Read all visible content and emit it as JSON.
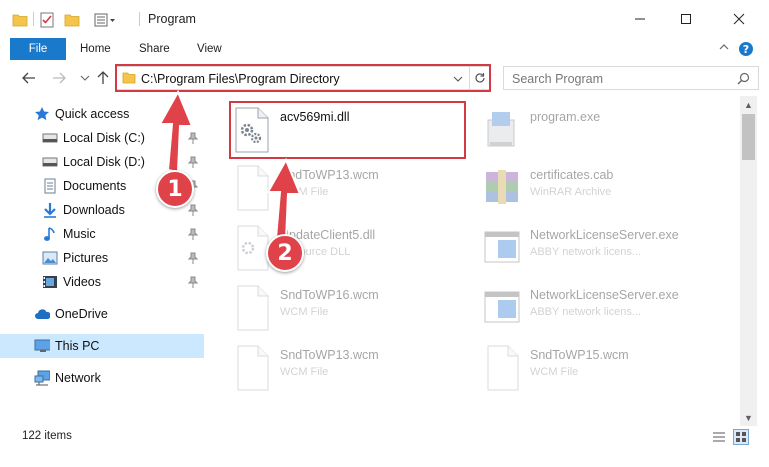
{
  "window": {
    "title": "Program",
    "minimize_icon": "minimize-icon",
    "maximize_icon": "maximize-icon",
    "close_icon": "close-icon"
  },
  "ribbon": {
    "file_tab": "File",
    "tabs": [
      "Home",
      "Share",
      "View"
    ]
  },
  "address": {
    "path": "C:\\Program Files\\Program Directory",
    "search_placeholder": "Search Program"
  },
  "sidebar": {
    "items": [
      {
        "label": "Quick access",
        "icon": "star-icon"
      },
      {
        "label": "Local Disk (C:)",
        "icon": "drive-icon"
      },
      {
        "label": "Local Disk (D:)",
        "icon": "drive-icon"
      },
      {
        "label": "Documents",
        "icon": "documents-icon"
      },
      {
        "label": "Downloads",
        "icon": "download-icon"
      },
      {
        "label": "Music",
        "icon": "music-icon"
      },
      {
        "label": "Pictures",
        "icon": "pictures-icon"
      },
      {
        "label": "Videos",
        "icon": "videos-icon"
      },
      {
        "label": "OneDrive",
        "icon": "cloud-icon"
      },
      {
        "label": "This PC",
        "icon": "computer-icon"
      },
      {
        "label": "Network",
        "icon": "network-icon"
      }
    ]
  },
  "files": {
    "left": [
      {
        "name": "acv569mi.dll",
        "type": ""
      },
      {
        "name": "SndToWP13.wcm",
        "type": "WCM File"
      },
      {
        "name": "UpdateClient5.dll",
        "type": "Resource DLL"
      },
      {
        "name": "SndToWP16.wcm",
        "type": "WCM File"
      },
      {
        "name": "SndToWP13.wcm",
        "type": "WCM File"
      }
    ],
    "right": [
      {
        "name": "program.exe",
        "type": ""
      },
      {
        "name": "certificates.cab",
        "type": "WinRAR Archive"
      },
      {
        "name": "NetworkLicenseServer.exe",
        "type": "ABBY network licens..."
      },
      {
        "name": "NetworkLicenseServer.exe",
        "type": "ABBY network licens..."
      },
      {
        "name": "SndToWP15.wcm",
        "type": "WCM File"
      }
    ]
  },
  "status": {
    "item_count": "122 items"
  },
  "annotations": {
    "step1": "1",
    "step2": "2",
    "highlight_color": "#d43a43",
    "badge_color": "#e0424a"
  }
}
